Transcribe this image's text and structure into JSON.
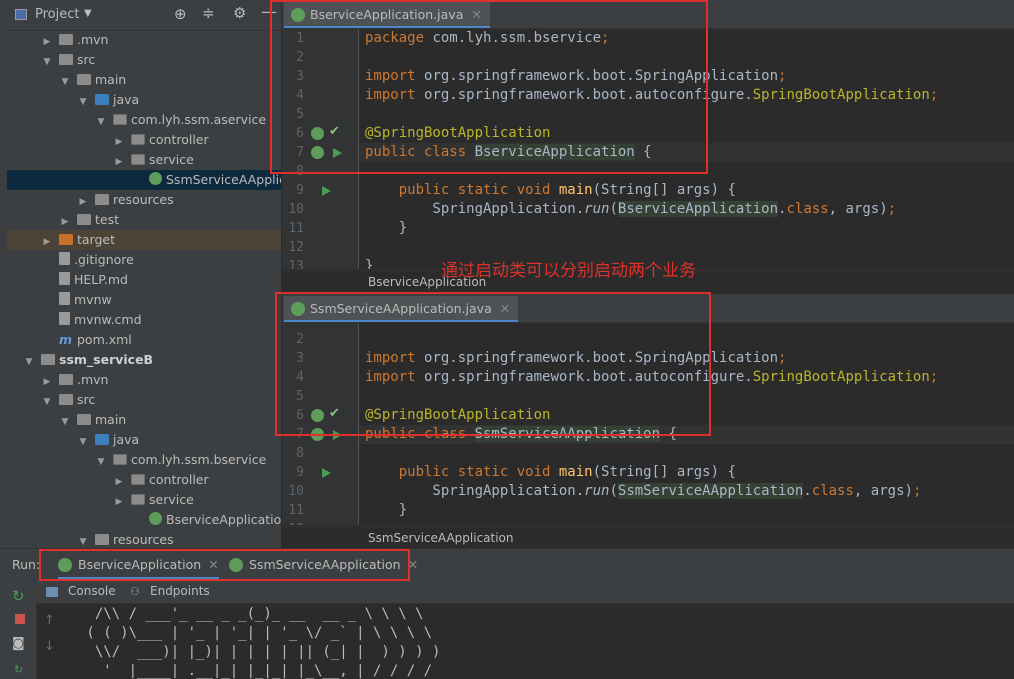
{
  "project_panel": {
    "title": "Project",
    "tree": [
      {
        "label": ".mvn",
        "indent": 2,
        "arrow": "right",
        "icon": "folder"
      },
      {
        "label": "src",
        "indent": 2,
        "arrow": "down",
        "icon": "folder"
      },
      {
        "label": "main",
        "indent": 3,
        "arrow": "down",
        "icon": "folder"
      },
      {
        "label": "java",
        "indent": 4,
        "arrow": "down",
        "icon": "folder-blue"
      },
      {
        "label": "com.lyh.ssm.aservice",
        "indent": 5,
        "arrow": "down",
        "icon": "package"
      },
      {
        "label": "controller",
        "indent": 6,
        "arrow": "right",
        "icon": "package"
      },
      {
        "label": "service",
        "indent": 6,
        "arrow": "right",
        "icon": "package"
      },
      {
        "label": "SsmServiceAApplication",
        "indent": 7,
        "arrow": "",
        "icon": "spring",
        "selected": true
      },
      {
        "label": "resources",
        "indent": 4,
        "arrow": "right",
        "icon": "folder"
      },
      {
        "label": "test",
        "indent": 3,
        "arrow": "right",
        "icon": "folder"
      },
      {
        "label": "target",
        "indent": 2,
        "arrow": "right",
        "icon": "folder-orange",
        "highlight": true
      },
      {
        "label": ".gitignore",
        "indent": 2,
        "arrow": "",
        "icon": "file"
      },
      {
        "label": "HELP.md",
        "indent": 2,
        "arrow": "",
        "icon": "file"
      },
      {
        "label": "mvnw",
        "indent": 2,
        "arrow": "",
        "icon": "file"
      },
      {
        "label": "mvnw.cmd",
        "indent": 2,
        "arrow": "",
        "icon": "file"
      },
      {
        "label": "pom.xml",
        "indent": 2,
        "arrow": "",
        "icon": "maven"
      },
      {
        "label": "ssm_serviceB",
        "indent": 1,
        "arrow": "down",
        "icon": "folder",
        "bold": true
      },
      {
        "label": ".mvn",
        "indent": 2,
        "arrow": "right",
        "icon": "folder"
      },
      {
        "label": "src",
        "indent": 2,
        "arrow": "down",
        "icon": "folder"
      },
      {
        "label": "main",
        "indent": 3,
        "arrow": "down",
        "icon": "folder"
      },
      {
        "label": "java",
        "indent": 4,
        "arrow": "down",
        "icon": "folder-blue"
      },
      {
        "label": "com.lyh.ssm.bservice",
        "indent": 5,
        "arrow": "down",
        "icon": "package"
      },
      {
        "label": "controller",
        "indent": 6,
        "arrow": "right",
        "icon": "package"
      },
      {
        "label": "service",
        "indent": 6,
        "arrow": "right",
        "icon": "package"
      },
      {
        "label": "BserviceApplication",
        "indent": 7,
        "arrow": "",
        "icon": "spring"
      },
      {
        "label": "resources",
        "indent": 4,
        "arrow": "down",
        "icon": "folder"
      }
    ]
  },
  "editor_top": {
    "tab": "BserviceApplication.java",
    "breadcrumb": "BserviceApplication",
    "lines": [
      {
        "n": "1",
        "code": [
          {
            "t": "package ",
            "c": "kw"
          },
          {
            "t": "com.lyh.ssm.bservice",
            "c": ""
          },
          {
            "t": ";",
            "c": "kw"
          }
        ]
      },
      {
        "n": "2",
        "code": []
      },
      {
        "n": "3",
        "code": [
          {
            "t": "import ",
            "c": "kw"
          },
          {
            "t": "org.springframework.boot.SpringApplication",
            "c": ""
          },
          {
            "t": ";",
            "c": "kw"
          }
        ]
      },
      {
        "n": "4",
        "code": [
          {
            "t": "import ",
            "c": "kw"
          },
          {
            "t": "org.springframework.boot.autoconfigure.",
            "c": ""
          },
          {
            "t": "SpringBootApplication",
            "c": "ann"
          },
          {
            "t": ";",
            "c": "kw"
          }
        ]
      },
      {
        "n": "5",
        "code": []
      },
      {
        "n": "6",
        "code": [
          {
            "t": "@SpringBootApplication",
            "c": "ann"
          }
        ]
      },
      {
        "n": "7",
        "code": [
          {
            "t": "public class ",
            "c": "kw"
          },
          {
            "t": "BserviceApplication",
            "c": "hlname"
          },
          {
            "t": " {",
            "c": ""
          }
        ],
        "caret": true
      },
      {
        "n": "8",
        "code": []
      },
      {
        "n": "9",
        "code": [
          {
            "t": "    public static void ",
            "c": "kw"
          },
          {
            "t": "main",
            "c": "fn"
          },
          {
            "t": "(String[] args) {",
            "c": ""
          }
        ]
      },
      {
        "n": "10",
        "code": [
          {
            "t": "        SpringApplication.",
            "c": ""
          },
          {
            "t": "run",
            "c": "it"
          },
          {
            "t": "(",
            "c": ""
          },
          {
            "t": "BserviceApplication",
            "c": "hlname"
          },
          {
            "t": ".",
            "c": ""
          },
          {
            "t": "class",
            "c": "kw"
          },
          {
            "t": ", args)",
            "c": ""
          },
          {
            "t": ";",
            "c": "kw"
          }
        ]
      },
      {
        "n": "11",
        "code": [
          {
            "t": "    }",
            "c": ""
          }
        ]
      },
      {
        "n": "12",
        "code": []
      },
      {
        "n": "13",
        "code": [
          {
            "t": "}",
            "c": ""
          }
        ]
      }
    ]
  },
  "editor_bottom": {
    "tab": "SsmServiceAApplication.java",
    "breadcrumb": "SsmServiceAApplication",
    "lines": [
      {
        "n": "2",
        "code": []
      },
      {
        "n": "3",
        "code": [
          {
            "t": "import ",
            "c": "kw"
          },
          {
            "t": "org.springframework.boot.SpringApplication",
            "c": ""
          },
          {
            "t": ";",
            "c": "kw"
          }
        ]
      },
      {
        "n": "4",
        "code": [
          {
            "t": "import ",
            "c": "kw"
          },
          {
            "t": "org.springframework.boot.autoconfigure.",
            "c": ""
          },
          {
            "t": "SpringBootApplication",
            "c": "ann"
          },
          {
            "t": ";",
            "c": "kw"
          }
        ]
      },
      {
        "n": "5",
        "code": []
      },
      {
        "n": "6",
        "code": [
          {
            "t": "@SpringBootApplication",
            "c": "ann"
          }
        ]
      },
      {
        "n": "7",
        "code": [
          {
            "t": "public class ",
            "c": "kw"
          },
          {
            "t": "SsmServiceAApplication",
            "c": "hlname"
          },
          {
            "t": " {",
            "c": ""
          }
        ],
        "caret": true
      },
      {
        "n": "8",
        "code": []
      },
      {
        "n": "9",
        "code": [
          {
            "t": "    public static void ",
            "c": "kw"
          },
          {
            "t": "main",
            "c": "fn"
          },
          {
            "t": "(String[] args) {",
            "c": ""
          }
        ]
      },
      {
        "n": "10",
        "code": [
          {
            "t": "        SpringApplication.",
            "c": ""
          },
          {
            "t": "run",
            "c": "it"
          },
          {
            "t": "(",
            "c": ""
          },
          {
            "t": "SsmServiceAApplication",
            "c": "hlname"
          },
          {
            "t": ".",
            "c": ""
          },
          {
            "t": "class",
            "c": "kw"
          },
          {
            "t": ", args)",
            "c": ""
          },
          {
            "t": ";",
            "c": "kw"
          }
        ]
      },
      {
        "n": "11",
        "code": [
          {
            "t": "    }",
            "c": ""
          }
        ]
      },
      {
        "n": "12",
        "code": []
      }
    ]
  },
  "annotation_note": "通过启动类可以分别启动两个业务",
  "run_panel": {
    "label": "Run:",
    "tabs": [
      {
        "label": "BserviceApplication",
        "active": true
      },
      {
        "label": "SsmServiceAApplication",
        "active": false
      }
    ],
    "console_tab": "Console",
    "endpoints_tab": "Endpoints",
    "banner": [
      "  /\\\\ / ___'_ __ _ _(_)_ __  __ _ \\ \\ \\ \\",
      " ( ( )\\___ | '_ | '_| | '_ \\/ _` | \\ \\ \\ \\",
      "  \\\\/  ___)| |_)| | | | | || (_| |  ) ) ) )",
      "   '  |____| .__|_| |_|_| |_\\__, | / / / /"
    ]
  },
  "colors": {
    "bg": "#2b2b2b",
    "panel": "#3c3f41",
    "keyword": "#cc7832",
    "annotation": "#bbb529",
    "method": "#ffc66d",
    "text": "#a9b7c6",
    "red_box": "#e0302b",
    "note_red": "#e0302b",
    "run_green": "#499c54"
  }
}
